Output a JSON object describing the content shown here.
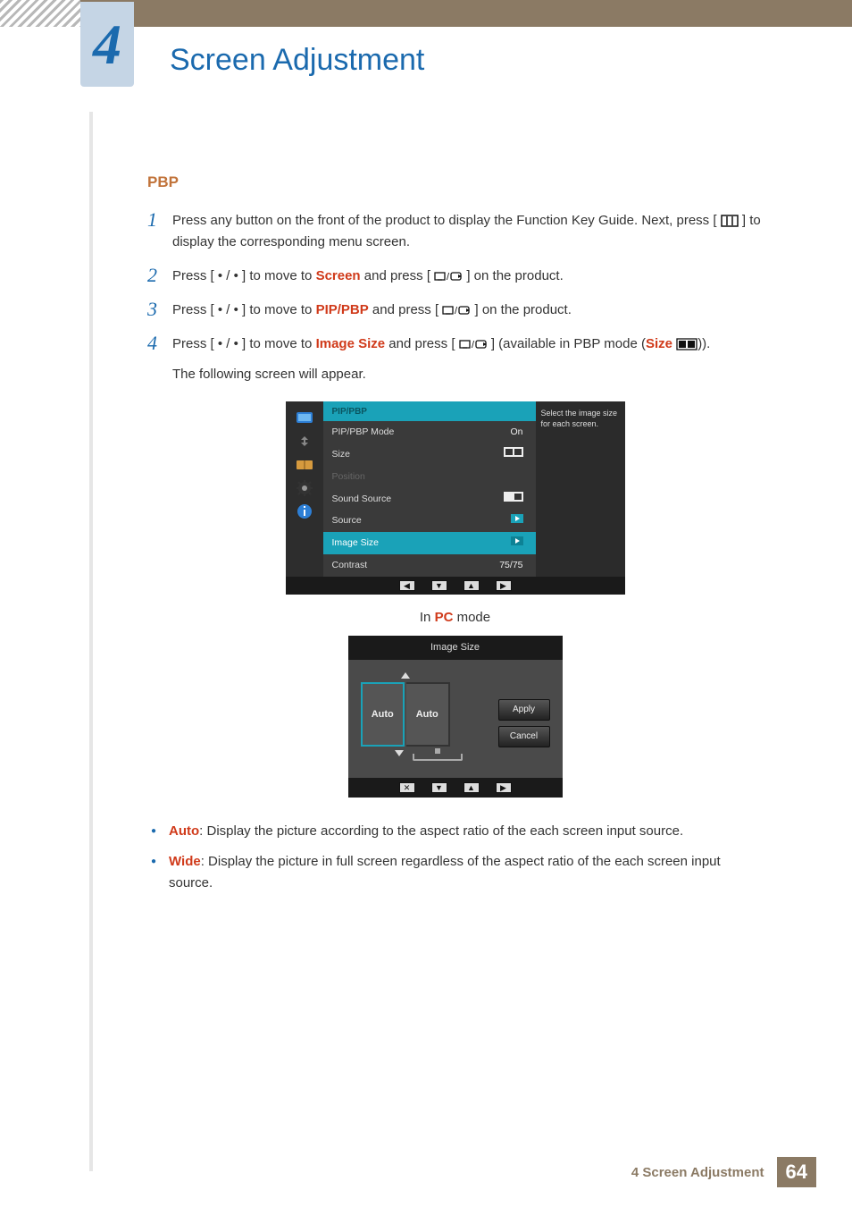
{
  "chapter": {
    "number": "4",
    "title": "Screen Adjustment"
  },
  "section": {
    "heading": "PBP"
  },
  "steps": {
    "s1": {
      "num": "1",
      "pre": "Press any button on the front of the product to display the Function Key Guide. Next, press [",
      "post": "] to display the corresponding menu screen."
    },
    "s2": {
      "num": "2",
      "pre": "Press [ • / • ] to move to ",
      "kw": "Screen",
      "mid": " and press [",
      "post": "] on the product."
    },
    "s3": {
      "num": "3",
      "pre": "Press [ • / • ] to move to ",
      "kw": "PIP/PBP",
      "mid": " and press [",
      "post": "] on the product."
    },
    "s4": {
      "num": "4",
      "pre": "Press [ • / • ] to move to ",
      "kw": "Image Size",
      "mid": " and press [",
      "mid2": "] (available in PBP mode (",
      "kw2": "Size",
      "post": ")).",
      "follow": "The following screen will appear."
    }
  },
  "osd1": {
    "title": "PIP/PBP",
    "hint": "Select the image size for each screen.",
    "items": {
      "mode": {
        "label": "PIP/PBP Mode",
        "value": "On"
      },
      "size": {
        "label": "Size"
      },
      "pos": {
        "label": "Position"
      },
      "ssrc": {
        "label": "Sound Source"
      },
      "src": {
        "label": "Source"
      },
      "imgsz": {
        "label": "Image Size"
      },
      "cont": {
        "label": "Contrast",
        "value": "75/75"
      }
    }
  },
  "caption": {
    "pre": "In ",
    "kw": "PC",
    "post": " mode"
  },
  "osd2": {
    "title": "Image Size",
    "left": "Auto",
    "right": "Auto",
    "apply": "Apply",
    "cancel": "Cancel"
  },
  "bullets": {
    "auto": {
      "kw": "Auto",
      "text": ": Display the picture according to the aspect ratio of the each screen input source."
    },
    "wide": {
      "kw": "Wide",
      "text": ": Display the picture in full screen regardless of the aspect ratio of the each screen input source."
    }
  },
  "footer": {
    "text": "4 Screen Adjustment",
    "page": "64"
  }
}
